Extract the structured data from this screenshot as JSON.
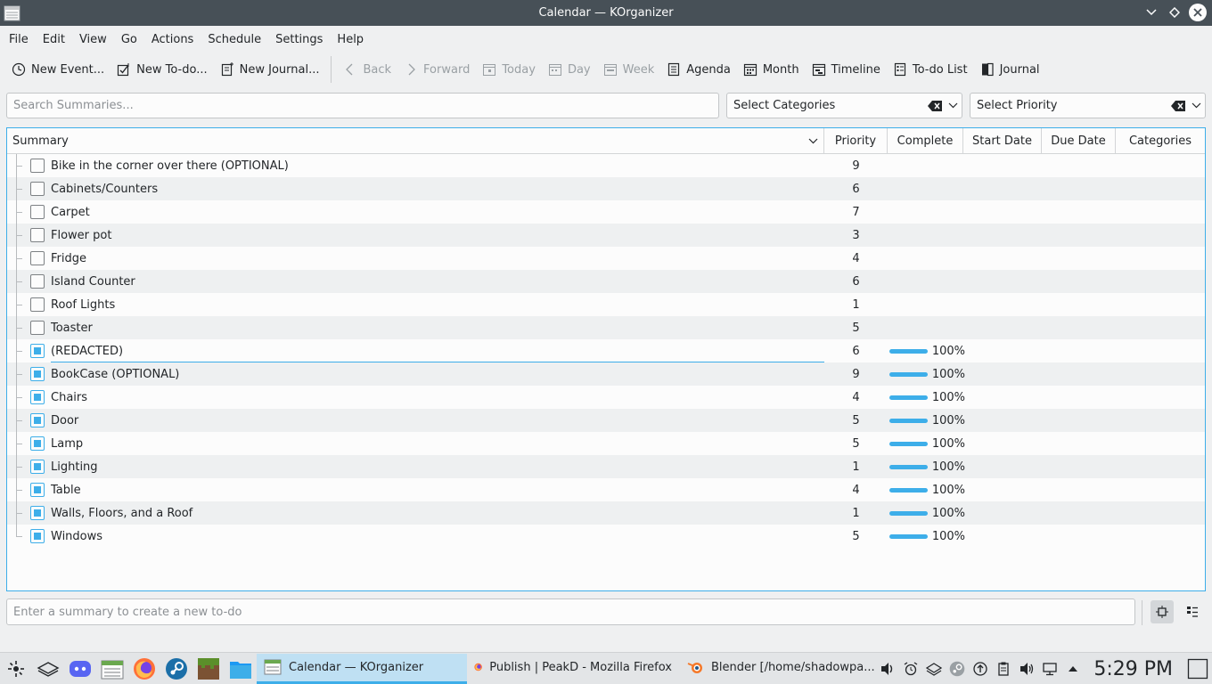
{
  "window": {
    "title": "Calendar — KOrganizer"
  },
  "menu": [
    "File",
    "Edit",
    "View",
    "Go",
    "Actions",
    "Schedule",
    "Settings",
    "Help"
  ],
  "toolbar": {
    "new_event": "New Event...",
    "new_todo": "New To-do...",
    "new_journal": "New Journal...",
    "back": "Back",
    "forward": "Forward",
    "today": "Today",
    "day": "Day",
    "week": "Week",
    "agenda": "Agenda",
    "month": "Month",
    "timeline": "Timeline",
    "todo_list": "To-do List",
    "journal": "Journal"
  },
  "filters": {
    "search_placeholder": "Search Summaries...",
    "categories": "Select Categories",
    "priority": "Select Priority"
  },
  "columns": {
    "summary": "Summary",
    "priority": "Priority",
    "complete": "Complete",
    "start_date": "Start Date",
    "due_date": "Due Date",
    "categories": "Categories"
  },
  "todos": [
    {
      "summary": "Bike in the corner over there (OPTIONAL)",
      "priority": "9",
      "done": false,
      "complete": ""
    },
    {
      "summary": "Cabinets/Counters",
      "priority": "6",
      "done": false,
      "complete": ""
    },
    {
      "summary": "Carpet",
      "priority": "7",
      "done": false,
      "complete": ""
    },
    {
      "summary": "Flower pot",
      "priority": "3",
      "done": false,
      "complete": ""
    },
    {
      "summary": "Fridge",
      "priority": "4",
      "done": false,
      "complete": ""
    },
    {
      "summary": "Island Counter",
      "priority": "6",
      "done": false,
      "complete": ""
    },
    {
      "summary": "Roof Lights",
      "priority": "1",
      "done": false,
      "complete": ""
    },
    {
      "summary": "Toaster",
      "priority": "5",
      "done": false,
      "complete": ""
    },
    {
      "summary": "(REDACTED)",
      "priority": "6",
      "done": true,
      "complete": "100%"
    },
    {
      "summary": "BookCase (OPTIONAL)",
      "priority": "9",
      "done": true,
      "complete": "100%"
    },
    {
      "summary": "Chairs",
      "priority": "4",
      "done": true,
      "complete": "100%"
    },
    {
      "summary": "Door",
      "priority": "5",
      "done": true,
      "complete": "100%"
    },
    {
      "summary": "Lamp",
      "priority": "5",
      "done": true,
      "complete": "100%"
    },
    {
      "summary": "Lighting",
      "priority": "1",
      "done": true,
      "complete": "100%"
    },
    {
      "summary": "Table",
      "priority": "4",
      "done": true,
      "complete": "100%"
    },
    {
      "summary": "Walls, Floors, and a Roof",
      "priority": "1",
      "done": true,
      "complete": "100%"
    },
    {
      "summary": "Windows",
      "priority": "5",
      "done": true,
      "complete": "100%"
    }
  ],
  "quick_add": {
    "placeholder": "Enter a summary to create a new to-do"
  },
  "taskbar": {
    "tasks": [
      {
        "label": "Calendar  — KOrganizer",
        "active": true
      },
      {
        "label": "Publish | PeakD - Mozilla Firefox",
        "active": false
      },
      {
        "label": "Blender [/home/shadowpa...",
        "active": false
      }
    ],
    "clock": "5:29 PM"
  },
  "colors": {
    "accent": "#3daee9",
    "titlebar": "#475057"
  }
}
